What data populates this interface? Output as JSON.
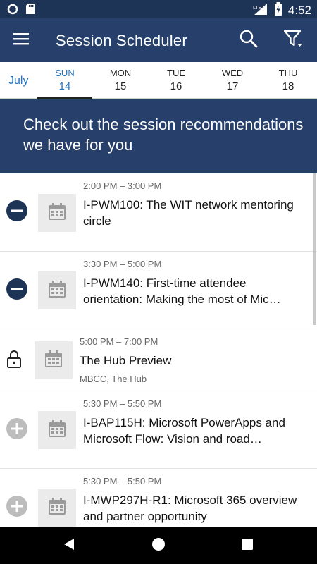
{
  "status": {
    "time": "4:52",
    "network": "LTE"
  },
  "appbar": {
    "title": "Session Scheduler"
  },
  "dates": {
    "month": "July",
    "days": [
      {
        "dow": "SUN",
        "num": "14"
      },
      {
        "dow": "MON",
        "num": "15"
      },
      {
        "dow": "TUE",
        "num": "16"
      },
      {
        "dow": "WED",
        "num": "17"
      },
      {
        "dow": "THU",
        "num": "18"
      }
    ],
    "selected_index": 0
  },
  "banner": {
    "text": "Check out the session recommendations we have for you"
  },
  "sessions": [
    {
      "time": "2:00 PM – 3:00 PM",
      "title": "I-PWM100: The WIT network mentoring circle",
      "location": "",
      "action": "remove-icon"
    },
    {
      "time": "3:30 PM – 5:00 PM",
      "title": "I-PWM140: First-time attendee orientation: Making the most of Mic…",
      "location": "",
      "action": "remove-icon"
    },
    {
      "time": "5:00 PM – 7:00 PM",
      "title": "The Hub Preview",
      "location": "MBCC, The Hub",
      "action": "lock-icon"
    },
    {
      "time": "5:30 PM – 5:50 PM",
      "title": "I-BAP115H: Microsoft PowerApps and Microsoft Flow: Vision and road…",
      "location": "",
      "action": "add-icon"
    },
    {
      "time": "5:30 PM – 5:50 PM",
      "title": "I-MWP297H-R1: Microsoft 365 overview and partner opportunity",
      "location": "",
      "action": "add-icon"
    }
  ],
  "colors": {
    "header": "#27406b",
    "statusbar": "#1e3457",
    "accent": "#1f74c6",
    "remove": "#1e3457",
    "add": "#bdbdbd"
  }
}
